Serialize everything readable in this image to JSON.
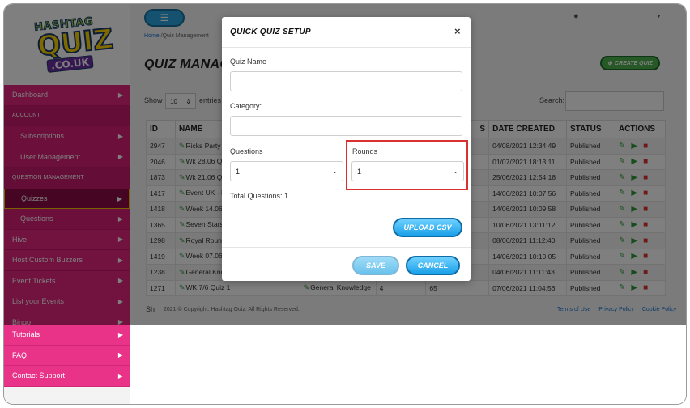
{
  "sidebar": {
    "logo": {
      "line1": "HASHTAG",
      "line2": "QUIZ",
      "line3": ".CO.UK"
    },
    "items": [
      {
        "label": "Dashboard",
        "kind": "item"
      },
      {
        "label": "ACCOUNT",
        "kind": "section"
      },
      {
        "label": "Subscriptions",
        "kind": "sub"
      },
      {
        "label": "User Management",
        "kind": "sub"
      },
      {
        "label": "QUESTION MANAGEMENT",
        "kind": "section"
      },
      {
        "label": "Quizzes",
        "kind": "sub-active"
      },
      {
        "label": "Questions",
        "kind": "sub"
      },
      {
        "label": "Hive",
        "kind": "item"
      },
      {
        "label": "Host Custom Buzzers",
        "kind": "item"
      },
      {
        "label": "Event Tickets",
        "kind": "item"
      },
      {
        "label": "List your Events",
        "kind": "item"
      },
      {
        "label": "Bingo",
        "kind": "item"
      }
    ],
    "bottom_items": [
      {
        "label": "Tutorials"
      },
      {
        "label": "FAQ"
      },
      {
        "label": "Contact Support"
      }
    ]
  },
  "header": {
    "breadcrumb_home": "Home",
    "breadcrumb_rest": " /Quiz Management",
    "page_title": "QUIZ MANAGEMENT",
    "create_label": "CREATE QUIZ"
  },
  "table_controls": {
    "show_label": "Show",
    "show_value": "10",
    "entries_label": "entries",
    "search_label": "Search:"
  },
  "table": {
    "columns": [
      "ID",
      "NAME",
      "",
      "",
      "S",
      "DATE CREATED",
      "STATUS",
      "ACTIONS"
    ],
    "rows": [
      {
        "id": "2947",
        "name": "Ricks Party",
        "date": "04/08/2021 12:34:49",
        "status": "Published"
      },
      {
        "id": "2046",
        "name": "Wk 28.06 Qu",
        "date": "01/07/2021 18:13:11",
        "status": "Published"
      },
      {
        "id": "1873",
        "name": "Wk 21.06 Qu",
        "date": "25/06/2021 12:54:18",
        "status": "Published"
      },
      {
        "id": "1417",
        "name": "Event UK - M",
        "date": "14/06/2021 10:07:56",
        "status": "Published"
      },
      {
        "id": "1418",
        "name": "Week 14.06",
        "date": "14/06/2021 10:09:58",
        "status": "Published"
      },
      {
        "id": "1365",
        "name": "Seven Stars",
        "date": "10/06/2021 13:11:12",
        "status": "Published"
      },
      {
        "id": "1298",
        "name": "Royal Round",
        "date": "08/06/2021 11:12:40",
        "status": "Published"
      },
      {
        "id": "1419",
        "name": "Week 07.06",
        "date": "14/06/2021 10:10:05",
        "status": "Published"
      },
      {
        "id": "1238",
        "name": "General Kno",
        "date": "04/06/2021 11:11:43",
        "status": "Published"
      },
      {
        "id": "1271",
        "name": "WK 7/6 Quiz 1",
        "category": "General Knowledge",
        "c4": "4",
        "c5": "65",
        "date": "07/06/2021 11:04:56",
        "status": "Published"
      }
    ]
  },
  "footer": {
    "show": "Sh",
    "copyright": "2021 © Copyright. Hashtag Quiz. All Rights Reserved.",
    "links": [
      "Terms of Use",
      "Privacy Policy",
      "Cookie Policy"
    ]
  },
  "modal": {
    "title": "QUICK QUIZ SETUP",
    "close": "×",
    "quiz_name_label": "Quiz Name",
    "category_label": "Category:",
    "questions_label": "Questions",
    "questions_value": "1",
    "rounds_label": "Rounds",
    "rounds_value": "1",
    "total_questions": "Total Questions: 1",
    "upload_label": "UPLOAD CSV",
    "save_label": "SAVE",
    "cancel_label": "CANCEL"
  },
  "colors": {
    "sidebar_pink": "#e2247e",
    "accent_blue": "#1aa0e8",
    "create_green": "#4db34a",
    "highlight_red": "#d93030"
  }
}
